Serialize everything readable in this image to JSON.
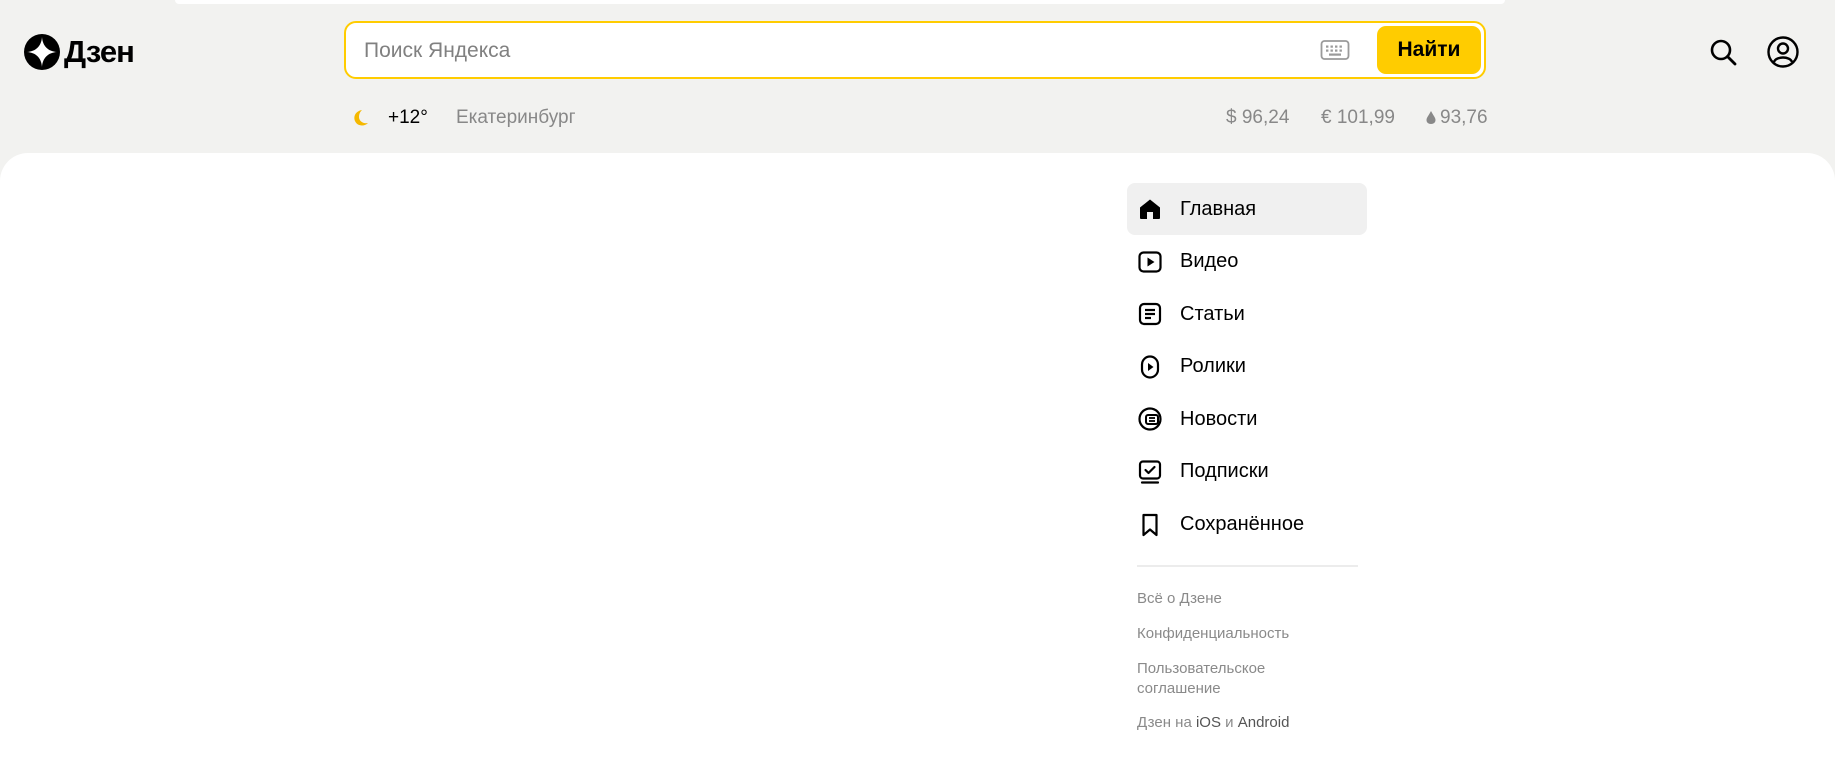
{
  "brand": {
    "name": "Дзен",
    "accent": "#ffcc00"
  },
  "search": {
    "placeholder": "Поиск Яндекса",
    "value": "",
    "button_label": "Найти"
  },
  "info": {
    "temperature": "+12°",
    "city": "Екатеринбург",
    "usd": "$ 96,24",
    "eur": "€ 101,99",
    "oil": "93,76"
  },
  "nav": {
    "items": [
      {
        "label": "Главная",
        "icon": "home-icon",
        "active": true
      },
      {
        "label": "Видео",
        "icon": "video-icon"
      },
      {
        "label": "Статьи",
        "icon": "articles-icon"
      },
      {
        "label": "Ролики",
        "icon": "shorts-icon"
      },
      {
        "label": "Новости",
        "icon": "news-icon"
      },
      {
        "label": "Подписки",
        "icon": "subscriptions-icon"
      },
      {
        "label": "Сохранённое",
        "icon": "bookmark-icon"
      }
    ]
  },
  "footer": {
    "about": "Всё о Дзене",
    "privacy": "Конфиденциальность",
    "terms": "Пользовательское соглашение",
    "apps_prefix": "Дзен на",
    "ios": "iOS",
    "and": "и",
    "android": "Android"
  }
}
